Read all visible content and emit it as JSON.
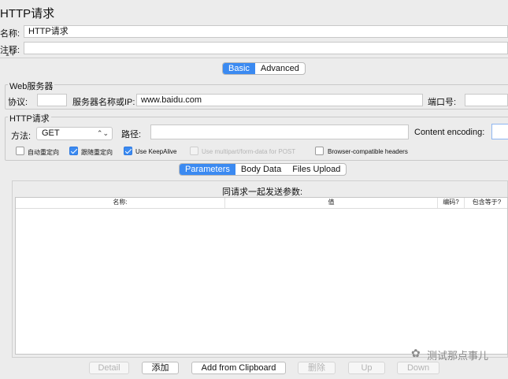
{
  "title": "HTTP请求",
  "name_label": "名称:",
  "name_value": "HTTP请求",
  "comment_label": "注释:",
  "comment_value": "",
  "top_tabs": {
    "basic": "Basic",
    "advanced": "Advanced"
  },
  "web_server": {
    "legend": "Web服务器",
    "protocol_label": "协议:",
    "protocol_value": "",
    "server_label": "服务器名称或IP:",
    "server_value": "www.baidu.com",
    "port_label": "端口号:",
    "port_value": ""
  },
  "http_request": {
    "legend": "HTTP请求",
    "method_label": "方法:",
    "method_value": "GET",
    "path_label": "路径:",
    "path_value": "",
    "encoding_label": "Content encoding:",
    "encoding_value": ""
  },
  "options": [
    {
      "label": "自动重定向",
      "checked": false,
      "disabled": false
    },
    {
      "label": "跟随重定向",
      "checked": true,
      "disabled": false
    },
    {
      "label": "Use KeepAlive",
      "checked": true,
      "disabled": false
    },
    {
      "label": "Use multipart/form-data for POST",
      "checked": false,
      "disabled": true
    },
    {
      "label": "Browser-compatible headers",
      "checked": false,
      "disabled": false
    }
  ],
  "sub_tabs": {
    "parameters": "Parameters",
    "body_data": "Body Data",
    "files_upload": "Files Upload"
  },
  "params_table": {
    "caption": "同请求一起发送参数:",
    "columns": {
      "name": "名称:",
      "value": "值",
      "encode": "编码?",
      "include_equals": "包含等于?"
    }
  },
  "buttons": {
    "detail": "Detail",
    "add": "添加",
    "add_clipboard": "Add from Clipboard",
    "delete": "删除",
    "up": "Up",
    "down": "Down"
  },
  "watermark": "测试那点事儿"
}
